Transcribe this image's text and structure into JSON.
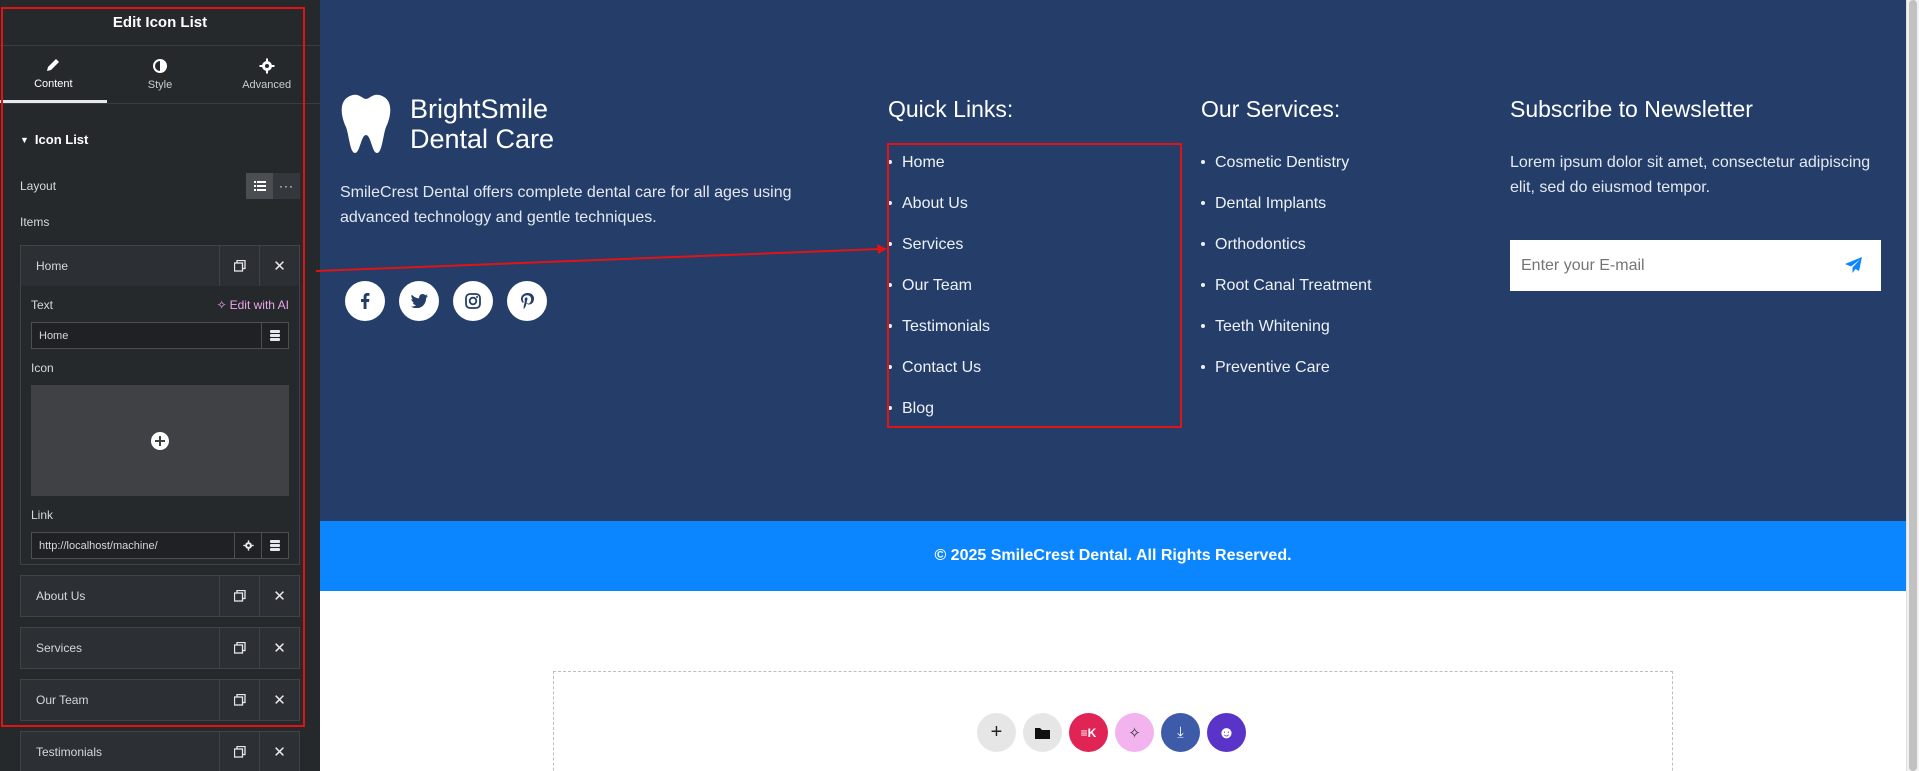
{
  "panel": {
    "title": "Edit Icon List",
    "tabs": [
      {
        "label": "Content",
        "icon": "pencil-icon"
      },
      {
        "label": "Style",
        "icon": "half-circle-icon"
      },
      {
        "label": "Advanced",
        "icon": "gear-icon"
      }
    ],
    "section_title": "Icon List",
    "layout_label": "Layout",
    "items_label": "Items",
    "items": [
      {
        "label": "Home"
      },
      {
        "label": "About Us"
      },
      {
        "label": "Services"
      },
      {
        "label": "Our Team"
      },
      {
        "label": "Testimonials"
      }
    ],
    "editor": {
      "text_label": "Text",
      "ai_label": "Edit with AI",
      "text_value": "Home",
      "icon_label": "Icon",
      "link_label": "Link",
      "link_value": "http://localhost/machine/"
    }
  },
  "footer": {
    "brand_line1": "BrightSmile",
    "brand_line2": "Dental Care",
    "about": "SmileCrest Dental offers complete dental care for all ages using advanced technology and gentle techniques.",
    "socials": [
      "facebook-icon",
      "twitter-icon",
      "instagram-icon",
      "pinterest-icon"
    ],
    "quick_links_title": "Quick Links:",
    "quick_links": [
      "Home",
      "About Us",
      "Services",
      "Our Team",
      "Testimonials",
      "Contact Us",
      "Blog"
    ],
    "services_title": "Our Services:",
    "services": [
      "Cosmetic Dentistry",
      "Dental Implants",
      "Orthodontics",
      "Root Canal Treatment",
      "Teeth Whitening",
      "Preventive Care"
    ],
    "newsletter_title": "Subscribe to Newsletter",
    "newsletter_text": "Lorem ipsum dolor sit amet, consectetur adipiscing elit, sed do eiusmod tempor.",
    "email_placeholder": "Enter your E-mail",
    "copyright": "© 2025 SmileCrest Dental. All Rights Reserved."
  },
  "colors": {
    "panel_bg": "#26292c",
    "footer_bg": "#243e69",
    "copyright_bg": "#0c86fe",
    "accent_send": "#0c86fe",
    "annotation": "#e01414"
  }
}
